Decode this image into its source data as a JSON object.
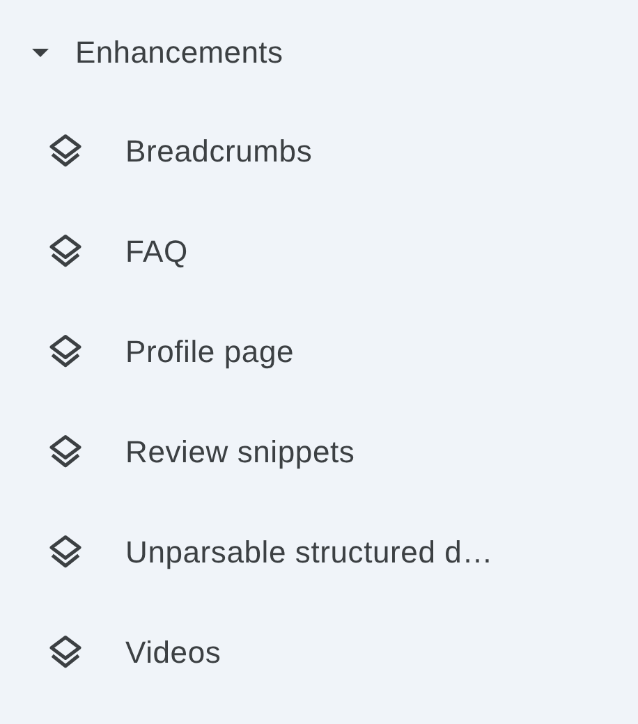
{
  "section": {
    "title": "Enhancements",
    "expanded": true,
    "items": [
      {
        "label": "Breadcrumbs"
      },
      {
        "label": "FAQ"
      },
      {
        "label": "Profile page"
      },
      {
        "label": "Review snippets"
      },
      {
        "label": "Unparsable structured d…"
      },
      {
        "label": "Videos"
      }
    ]
  }
}
